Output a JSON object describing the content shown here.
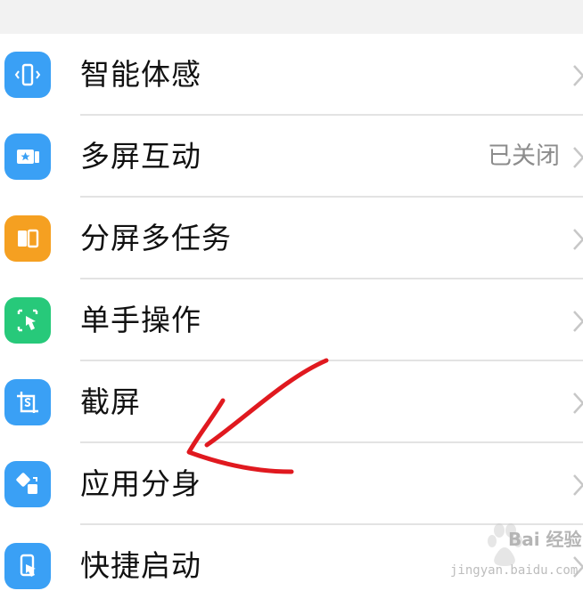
{
  "settings": {
    "items": [
      {
        "label": "智能体感",
        "value": "",
        "icon": "phone-motion-icon",
        "color": "#3aa0f5"
      },
      {
        "label": "多屏互动",
        "value": "已关闭",
        "icon": "multi-screen-icon",
        "color": "#3aa0f5"
      },
      {
        "label": "分屏多任务",
        "value": "",
        "icon": "split-screen-icon",
        "color": "#f5a021"
      },
      {
        "label": "单手操作",
        "value": "",
        "icon": "one-hand-icon",
        "color": "#27c97a"
      },
      {
        "label": "截屏",
        "value": "",
        "icon": "screenshot-icon",
        "color": "#3aa0f5"
      },
      {
        "label": "应用分身",
        "value": "",
        "icon": "app-clone-icon",
        "color": "#3aa0f5"
      },
      {
        "label": "快捷启动",
        "value": "",
        "icon": "quick-launch-icon",
        "color": "#3aa0f5"
      }
    ]
  },
  "annotation": {
    "type": "red-arrow",
    "color": "#e0191f"
  },
  "watermark": {
    "brand": "Bai 经验",
    "url": "jingyan.baidu.com"
  }
}
